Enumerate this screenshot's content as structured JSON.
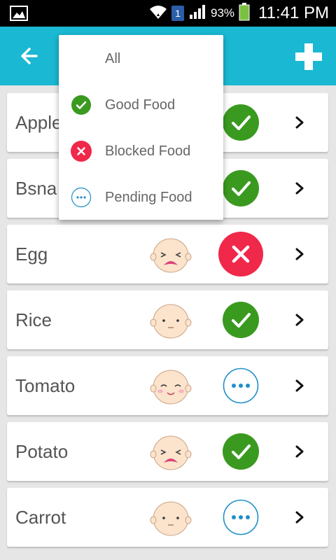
{
  "status_bar": {
    "sim_number": "1",
    "battery_percent": "93%",
    "time": "11:41 PM",
    "icons": [
      "image-icon",
      "wifi-icon",
      "sim-icon",
      "signal-icon",
      "battery-icon"
    ]
  },
  "app_bar": {
    "color": "#1ab8d2",
    "back_icon": "arrow-left-icon",
    "add_icon": "plus-icon"
  },
  "filter_menu": {
    "items": [
      {
        "label": "All",
        "icon": "none"
      },
      {
        "label": "Good Food",
        "icon": "check-circle-icon"
      },
      {
        "label": "Blocked Food",
        "icon": "x-circle-icon"
      },
      {
        "label": "Pending Food",
        "icon": "dots-circle-icon"
      }
    ]
  },
  "foods": [
    {
      "name": "Apple",
      "face": "none",
      "status": "good"
    },
    {
      "name": "Bsna",
      "face": "none",
      "status": "good"
    },
    {
      "name": "Egg",
      "face": "crying",
      "status": "blocked"
    },
    {
      "name": "Rice",
      "face": "neutral",
      "status": "good"
    },
    {
      "name": "Tomato",
      "face": "happy",
      "status": "pending"
    },
    {
      "name": "Potato",
      "face": "crying",
      "status": "good"
    },
    {
      "name": "Carrot",
      "face": "neutral",
      "status": "pending"
    }
  ],
  "colors": {
    "good": "#3a9a1f",
    "blocked": "#f0284a",
    "pending": "#1f8fc8"
  }
}
